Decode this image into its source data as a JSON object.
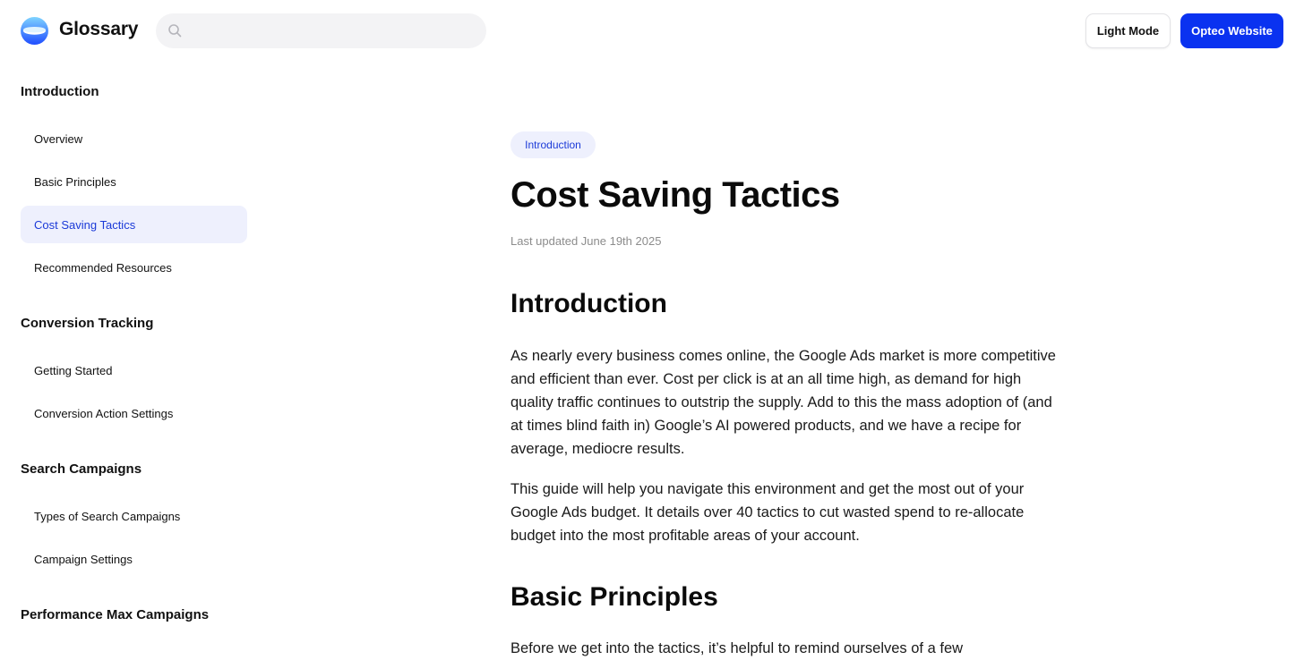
{
  "header": {
    "logo_text": "Glossary",
    "search_placeholder": "",
    "light_mode_label": "Light Mode",
    "opteo_website_label": "Opteo Website"
  },
  "sidebar": {
    "sections": [
      {
        "title": "Introduction",
        "items": [
          {
            "label": "Overview",
            "active": false
          },
          {
            "label": "Basic Principles",
            "active": false
          },
          {
            "label": "Cost Saving Tactics",
            "active": true
          },
          {
            "label": "Recommended Resources",
            "active": false
          }
        ]
      },
      {
        "title": "Conversion Tracking",
        "items": [
          {
            "label": "Getting Started",
            "active": false
          },
          {
            "label": "Conversion Action Settings",
            "active": false
          }
        ]
      },
      {
        "title": "Search Campaigns",
        "items": [
          {
            "label": "Types of Search Campaigns",
            "active": false
          },
          {
            "label": "Campaign Settings",
            "active": false
          }
        ]
      },
      {
        "title": "Performance Max Campaigns",
        "items": []
      }
    ]
  },
  "main": {
    "tag": "Introduction",
    "title": "Cost Saving Tactics",
    "last_updated": "Last updated June 19th 2025",
    "sections": [
      {
        "heading": "Introduction",
        "paragraphs": [
          "As nearly every business comes online, the Google Ads market is more competitive and efficient than ever. Cost per click is at an all time high, as demand for high quality traffic continues to outstrip the supply. Add to this the mass adoption of (and at times blind faith in) Google’s AI powered products, and we have a recipe for average, mediocre results.",
          "This guide will help you navigate this environment and get the most out of your Google Ads budget. It details over 40 tactics to cut wasted spend to re-allocate budget into the most profitable areas of your account."
        ]
      },
      {
        "heading": "Basic Principles",
        "paragraphs": [
          "Before we get into the tactics, it’s helpful to remind ourselves of a few"
        ]
      }
    ]
  },
  "colors": {
    "brand_blue": "#0a32f0",
    "active_bg": "#eef0fd",
    "active_text": "#1b3ad8"
  }
}
